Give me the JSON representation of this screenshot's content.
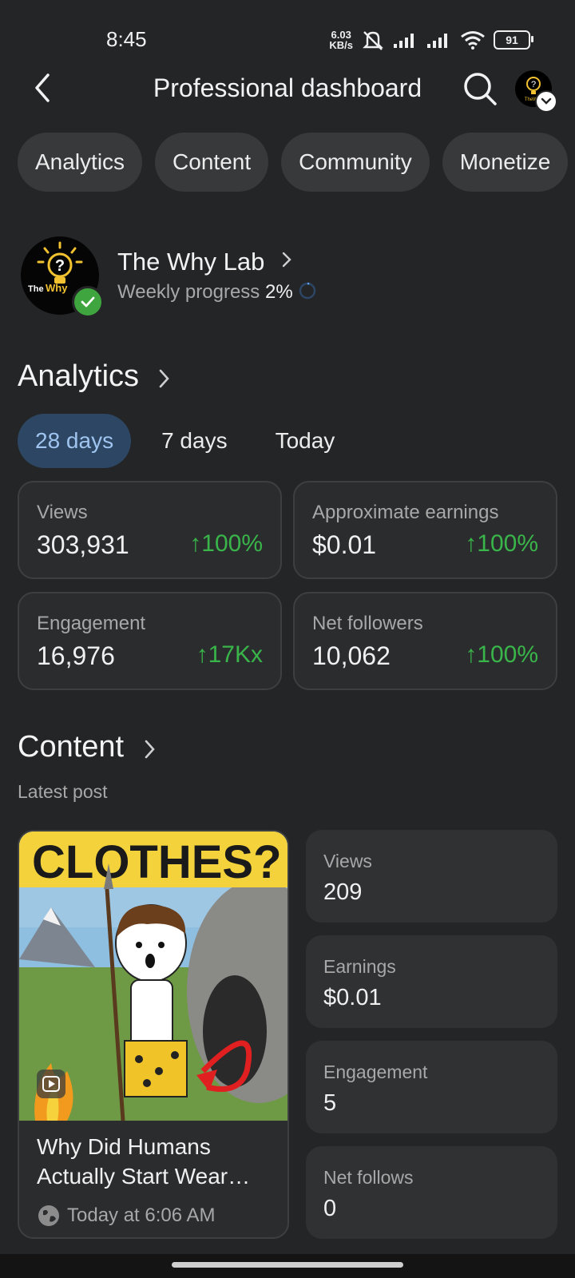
{
  "status": {
    "time": "8:45",
    "net_speed_top": "6.03",
    "net_speed_bottom": "KB/s",
    "battery": "91"
  },
  "header": {
    "title": "Professional dashboard"
  },
  "chips": [
    "Analytics",
    "Content",
    "Community",
    "Monetize"
  ],
  "profile": {
    "name": "The Why Lab",
    "progress_label": "Weekly progress",
    "progress_value": "2%",
    "progress_fraction": 0.02,
    "logo_text": "The Why"
  },
  "analytics": {
    "heading": "Analytics",
    "tabs": [
      "28 days",
      "7 days",
      "Today"
    ],
    "selected_tab": "28 days",
    "cards": [
      {
        "label": "Views",
        "value": "303,931",
        "delta": "↑100%"
      },
      {
        "label": "Approximate earnings",
        "value": "$0.01",
        "delta": "↑100%"
      },
      {
        "label": "Engagement",
        "value": "16,976",
        "delta": "↑17Kx"
      },
      {
        "label": "Net followers",
        "value": "10,062",
        "delta": "↑100%"
      }
    ]
  },
  "content": {
    "heading": "Content",
    "sub_label": "Latest post",
    "thumbnail_text": "CLOTHES?",
    "post_title": "Why Did Humans Actually Start Wear…",
    "post_time": "Today at 6:06 AM",
    "stats": [
      {
        "label": "Views",
        "value": "209"
      },
      {
        "label": "Earnings",
        "value": "$0.01"
      },
      {
        "label": "Engagement",
        "value": "5"
      },
      {
        "label": "Net follows",
        "value": "0"
      }
    ]
  },
  "colors": {
    "accent_green": "#39b54a",
    "tab_active_bg": "#2c4663",
    "tab_active_text": "#9fc4ef",
    "background": "#242527"
  }
}
